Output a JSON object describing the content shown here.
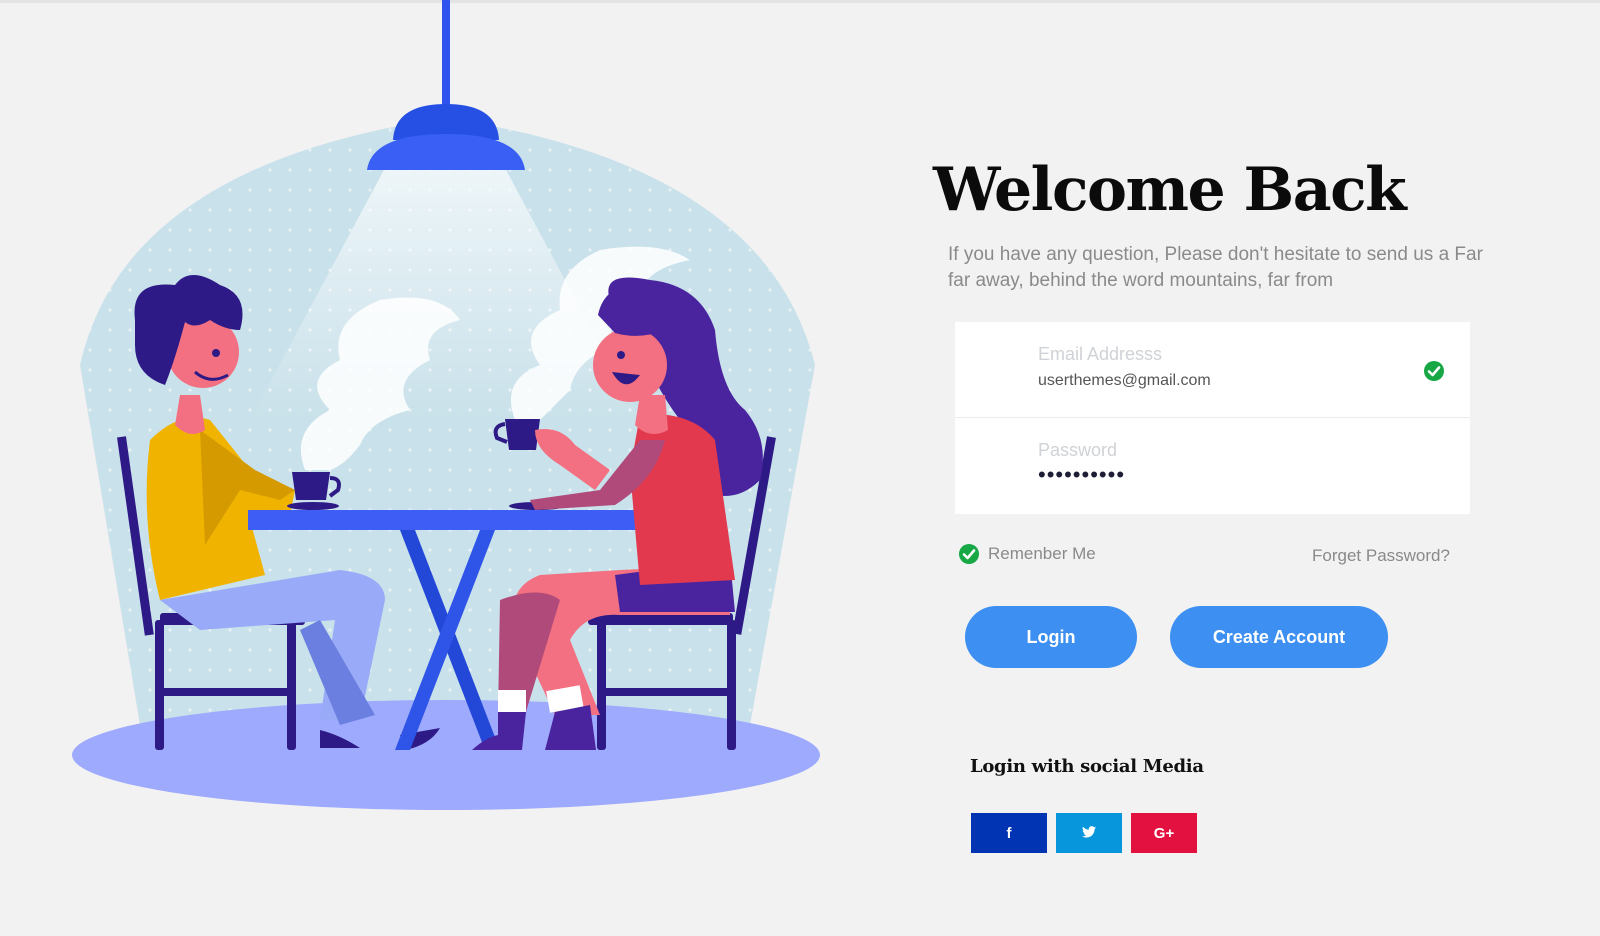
{
  "header": {
    "title": "Welcome Back",
    "subtitle": "If you have any question, Please don't hesitate to send us a Far far away, behind the word mountains, far from"
  },
  "form": {
    "email": {
      "label": "Email Addresss",
      "value": "userthemes@gmail.com",
      "status_icon": "check-circle-icon"
    },
    "password": {
      "label": "Password",
      "value": "••••••••••"
    },
    "remember_label": "Remenber Me",
    "remember_checked": true,
    "forgot_label": "Forget Password?"
  },
  "buttons": {
    "login": "Login",
    "create": "Create Account"
  },
  "social": {
    "heading": "Login with social Media",
    "items": [
      {
        "name": "facebook",
        "glyph": "f",
        "color": "#0134b3"
      },
      {
        "name": "twitter",
        "glyph": "🐦",
        "color": "#0796dc"
      },
      {
        "name": "google-plus",
        "glyph": "G+",
        "color": "#e31140"
      }
    ]
  },
  "colors": {
    "background": "#f2f2f2",
    "accent": "#3d8ff2",
    "check_green": "#17a745",
    "title": "#0b0b0b",
    "muted_text": "#8a8a8a"
  },
  "illustration": {
    "subject": "two-people-drinking-coffee-at-table",
    "icons": [
      "ceiling-lamp-icon",
      "coffee-cup-icon",
      "chair-icon",
      "table-icon"
    ]
  }
}
